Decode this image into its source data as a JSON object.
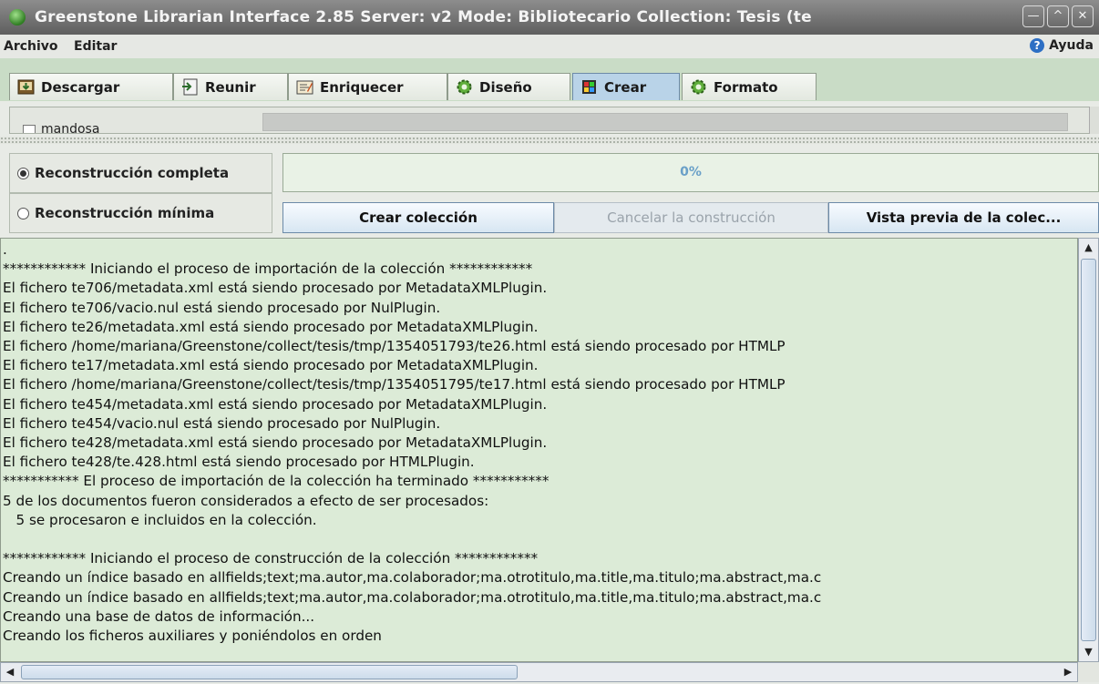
{
  "window": {
    "title": "Greenstone Librarian Interface 2.85  Server: v2  Mode: Bibliotecario  Collection: Tesis (te",
    "controls": [
      "—",
      "^",
      "✕"
    ]
  },
  "menu": {
    "archivo": "Archivo",
    "editar": "Editar",
    "ayuda": "Ayuda"
  },
  "tabs": [
    {
      "label": "Descargar",
      "icon": "download-icon"
    },
    {
      "label": "Reunir",
      "icon": "gather-icon"
    },
    {
      "label": "Enriquecer",
      "icon": "enrich-icon"
    },
    {
      "label": "Diseño",
      "icon": "design-gear-icon"
    },
    {
      "label": "Crear",
      "icon": "create-icon",
      "active": true
    },
    {
      "label": "Formato",
      "icon": "format-gear-icon"
    }
  ],
  "options_panel": {
    "checkbox_label": "mandosa",
    "checked": false
  },
  "build": {
    "full_rebuild_label": "Reconstrucción completa",
    "minimal_rebuild_label": "Reconstrucción mínima",
    "selected": "full",
    "progress_text": "0%",
    "progress_value": 0,
    "create_button": "Crear colección",
    "cancel_button": "Cancelar la construcción",
    "preview_button": "Vista previa de la colec..."
  },
  "log_lines": [
    ".",
    "************ Iniciando el proceso de importación de la colección ************",
    "El fichero te706/metadata.xml está siendo procesado por MetadataXMLPlugin.",
    "El fichero te706/vacio.nul está siendo procesado por NulPlugin.",
    "El fichero te26/metadata.xml está siendo procesado por MetadataXMLPlugin.",
    "El fichero /home/mariana/Greenstone/collect/tesis/tmp/1354051793/te26.html está siendo procesado por HTMLP",
    "El fichero te17/metadata.xml está siendo procesado por MetadataXMLPlugin.",
    "El fichero /home/mariana/Greenstone/collect/tesis/tmp/1354051795/te17.html está siendo procesado por HTMLP",
    "El fichero te454/metadata.xml está siendo procesado por MetadataXMLPlugin.",
    "El fichero te454/vacio.nul está siendo procesado por NulPlugin.",
    "El fichero te428/metadata.xml está siendo procesado por MetadataXMLPlugin.",
    "El fichero te428/te.428.html está siendo procesado por HTMLPlugin.",
    "*********** El proceso de importación de la colección ha terminado ***********",
    "5 de los documentos fueron considerados a efecto de ser procesados:",
    "   5 se procesaron e incluidos en la colección.",
    "",
    "************ Iniciando el proceso de construcción de la colección ************",
    "Creando un índice basado en allfields;text;ma.autor,ma.colaborador;ma.otrotitulo,ma.title,ma.titulo;ma.abstract,ma.c",
    "Creando un índice basado en allfields;text;ma.autor,ma.colaborador;ma.otrotitulo,ma.title,ma.titulo;ma.abstract,ma.c",
    "Creando una base de datos de información...",
    "Creando los ficheros auxiliares y poniéndolos en orden"
  ],
  "colors": {
    "tab_active": "#b9d3e8",
    "log_background": "#dcebd7",
    "tabbar": "#c9dcc6"
  }
}
